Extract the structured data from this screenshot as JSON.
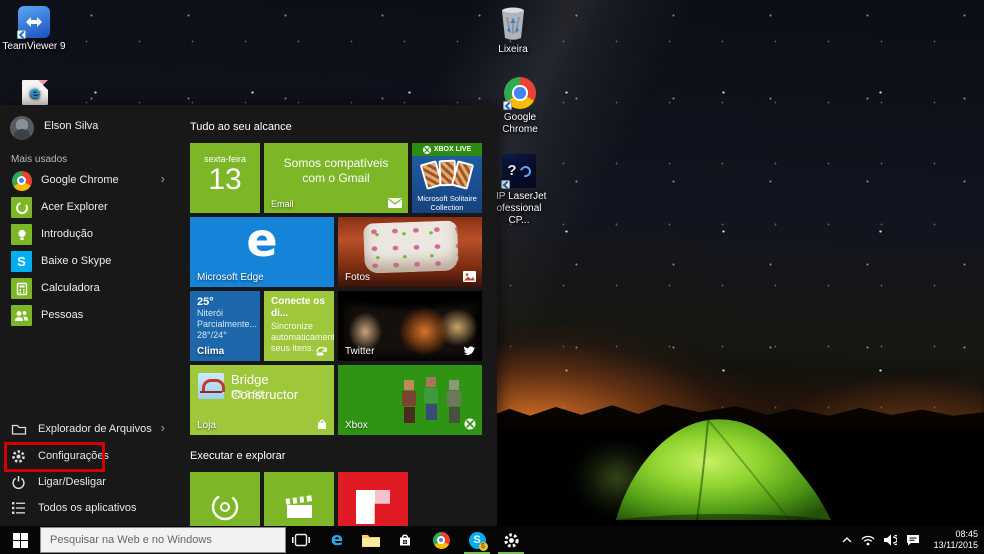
{
  "desktop": {
    "icons": {
      "teamviewer": "TeamViewer 9",
      "recycle_bin": "Lixeira",
      "chrome": "Google Chrome",
      "hp_line1": "HP LaserJet",
      "hp_line2": "ofessional CP..."
    }
  },
  "icons": {
    "edge_letter": "e",
    "skype_letter": "S",
    "skype_badge": "$",
    "hp_question": "?"
  },
  "start_menu": {
    "user_name": "Elson Silva",
    "most_used_header": "Mais usados",
    "chevron": "›",
    "most_used": [
      {
        "label": "Google Chrome"
      },
      {
        "label": "Acer Explorer"
      },
      {
        "label": "Introdução"
      },
      {
        "label": "Baixe o Skype"
      },
      {
        "label": "Calculadora"
      },
      {
        "label": "Pessoas"
      }
    ],
    "system_items": [
      {
        "label": "Explorador de Arquivos"
      },
      {
        "label": "Configurações"
      },
      {
        "label": "Ligar/Desligar"
      },
      {
        "label": "Todos os aplicativos"
      }
    ],
    "groups": {
      "first": "Tudo ao seu alcance",
      "second": "Executar e explorar"
    },
    "tiles": {
      "calendar": {
        "weekday": "sexta-feira",
        "day": "13"
      },
      "email": {
        "message": "Somos compatíveis com o Gmail",
        "label": "Email"
      },
      "solitaire": {
        "header": "XBOX LIVE",
        "caption": "Microsoft Solitaire Collection"
      },
      "edge": {
        "logo": "e",
        "label": "Microsoft Edge"
      },
      "fotos": {
        "label": "Fotos"
      },
      "clima": {
        "temp": "25°",
        "city": "Niterói",
        "condition": "Parcialmente...",
        "hilo": "28°/24°",
        "label": "Clima"
      },
      "conecte": {
        "title": "Conecte os di...",
        "body": "Sincronize automaticamente seus itens."
      },
      "twitter": {
        "label": "Twitter"
      },
      "loja": {
        "app_name": "Bridge Constructor",
        "price": "R$ 2,50",
        "label": "Loja"
      },
      "xbox": {
        "label": "Xbox"
      }
    }
  },
  "taskbar": {
    "search_placeholder": "Pesquisar na Web e no Windows",
    "clock": {
      "time": "08:45",
      "date": "13/11/2015"
    }
  },
  "colors": {
    "tile_green": "#7db626",
    "tile_lime": "#9ec73c",
    "edge_blue": "#1583d7",
    "clima_blue": "#1d68ad",
    "skype_blue": "#00aff0",
    "flipboard_red": "#e01b24",
    "xbox_green": "#2f9414",
    "solitaire_blue": "#2160a8",
    "solitaire_header_green": "#2e8b12",
    "highlight_red": "#d40000"
  }
}
